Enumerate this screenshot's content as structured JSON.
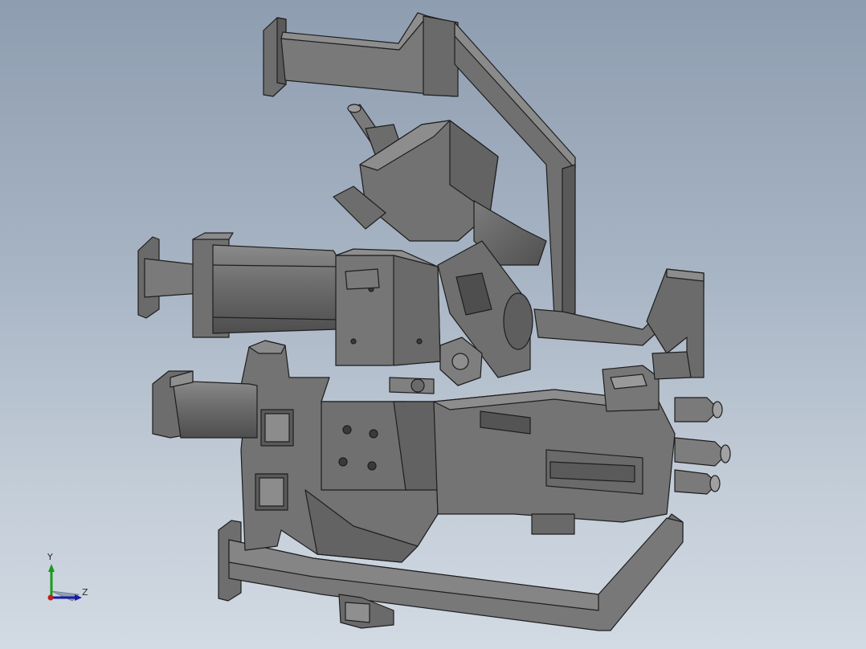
{
  "viewport": {
    "background_top": "#8e9db0",
    "background_bottom": "#d2dae3",
    "model_color": "#6f6f6f",
    "edge_color": "#1e1e1e"
  },
  "triad": {
    "y_label": "Y",
    "z_label": "Z",
    "x_color": "#c02020",
    "y_color": "#1a9a1a",
    "z_color": "#1a1aa8"
  }
}
